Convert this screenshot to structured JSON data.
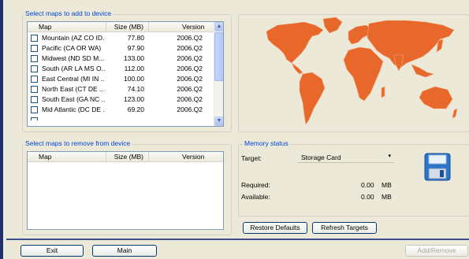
{
  "add_group": {
    "title": "Select maps to add to device",
    "columns": [
      "Map",
      "Size (MB)",
      "Version"
    ],
    "rows": [
      {
        "map": "Mountain (AZ CO ID...",
        "size": "77.80",
        "version": "2006.Q2"
      },
      {
        "map": "Pacific (CA OR WA)",
        "size": "97.90",
        "version": "2006.Q2"
      },
      {
        "map": "Midwest (ND SD M...",
        "size": "133.00",
        "version": "2006.Q2"
      },
      {
        "map": "South (AR LA MS O...",
        "size": "112.00",
        "version": "2006.Q2"
      },
      {
        "map": "East Central (MI IN ...",
        "size": "100.00",
        "version": "2006.Q2"
      },
      {
        "map": "North East (CT DE ...",
        "size": "74.10",
        "version": "2006.Q2"
      },
      {
        "map": "South East (GA NC ...",
        "size": "123.00",
        "version": "2006.Q2"
      },
      {
        "map": "Mid Atlantic (DC DE ...",
        "size": "69.20",
        "version": "2006.Q2"
      }
    ]
  },
  "remove_group": {
    "title": "Select maps to remove from device",
    "columns": [
      "Map",
      "Size (MB)",
      "Version"
    ]
  },
  "memory": {
    "title": "Memory status",
    "target_label": "Target:",
    "target_value": "Storage Card",
    "required_label": "Required:",
    "required_value": "0.00",
    "required_unit": "MB",
    "available_label": "Available:",
    "available_value": "0.00",
    "available_unit": "MB"
  },
  "buttons": {
    "restore_defaults": "Restore Defaults",
    "refresh_targets": "Refresh Targets",
    "exit": "Exit",
    "main": "Main",
    "add_remove": "Add/Remove"
  },
  "colors": {
    "map_fill": "#e8672a",
    "group_title": "#0046d5",
    "window_frame": "#1f2f6b"
  },
  "icons": {
    "world_map": "world-map-icon",
    "save": "floppy-disk-icon",
    "dropdown": "chevron-down-icon"
  }
}
